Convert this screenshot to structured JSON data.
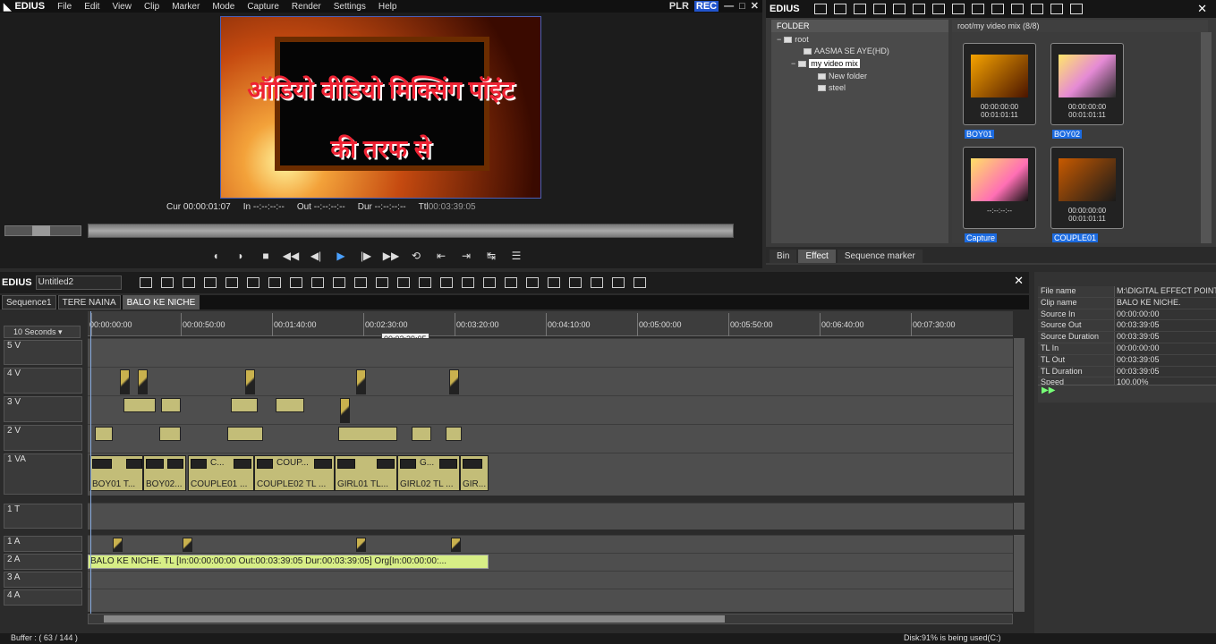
{
  "app": {
    "name": "EDIUS"
  },
  "menu": [
    "File",
    "Edit",
    "View",
    "Clip",
    "Marker",
    "Mode",
    "Capture",
    "Render",
    "Settings",
    "Help"
  ],
  "player": {
    "plr": "PLR",
    "rec": "REC",
    "preview_line1": "ऑडियो वीडियो मिक्सिंग पॉइंट",
    "preview_line2": "की तरफ से",
    "cur_label": "Cur",
    "cur": "00:00:01:07",
    "in_label": "In",
    "in": "--:--:--:--",
    "out_label": "Out",
    "out": "--:--:--:--",
    "dur_label": "Dur",
    "dur": "--:--:--:--",
    "ttl_label": "Ttl",
    "ttl": "00:03:39:05"
  },
  "bin": {
    "title": "EDIUS",
    "folder_header": "FOLDER",
    "tree": [
      {
        "label": "root"
      },
      {
        "label": "AASMA SE AYE(HD)"
      },
      {
        "label": "my video mix",
        "selected": true
      },
      {
        "label": "New folder"
      },
      {
        "label": "steel"
      }
    ],
    "path": "root/my video mix (8/8)",
    "clips": [
      {
        "name": "BOY01",
        "tc1": "00:00:00:00",
        "tc2": "00:01:01:11"
      },
      {
        "name": "BOY02",
        "tc1": "00:00:00:00",
        "tc2": "00:01:01:11"
      },
      {
        "name": "Capture",
        "tc1": "--:--:--:--",
        "tc2": ""
      },
      {
        "name": "COUPLE01",
        "tc1": "00:00:00:00",
        "tc2": "00:01:01:11"
      }
    ],
    "tabs": [
      "Bin",
      "Effect",
      "Sequence marker"
    ]
  },
  "timeline": {
    "title": "EDIUS",
    "sequence_name": "Untitled2",
    "seq_tabs": [
      "Sequence1",
      "TERE NAINA",
      "BALO KE NICHE"
    ],
    "zoom": "10 Seconds",
    "ruler": [
      "00:00:00:00",
      "00:00:50:00",
      "00:01:40:00",
      "00:02:30:00",
      "00:03:20:00",
      "00:04:10:00",
      "00:05:00:00",
      "00:05:50:00",
      "00:06:40:00",
      "00:07:30:00"
    ],
    "tooltip": "00:02:39:05",
    "tracks": [
      "5 V",
      "4 V",
      "3 V",
      "2 V",
      "1 VA",
      "1 T",
      "1 A",
      "2 A",
      "3 A",
      "4 A"
    ],
    "va_clips": [
      {
        "label": "BOY01   T..."
      },
      {
        "label": "BOY02..."
      },
      {
        "label": "COUPLE01   ..."
      },
      {
        "label": "COUPLE02   TL ..."
      },
      {
        "label": "GIRL01   TL..."
      },
      {
        "label": "GIRL02   TL ..."
      },
      {
        "label": "GIR..."
      }
    ],
    "va_top_labels": [
      "C...",
      "COUP...",
      "G..."
    ],
    "audio_clip": "BALO KE NICHE.  TL [In:00:00:00:00 Out:00:03:39:05 Dur:00:03:39:05]  Org[In:00:00:00:..."
  },
  "info": [
    {
      "k": "File name",
      "v": "M:\\DIGITAL EFFECT POINT\\"
    },
    {
      "k": "Clip name",
      "v": "BALO KE NICHE."
    },
    {
      "k": "Source In",
      "v": "00:00:00:00"
    },
    {
      "k": "Source Out",
      "v": "00:03:39:05"
    },
    {
      "k": "Source Duration",
      "v": "00:03:39:05"
    },
    {
      "k": "TL In",
      "v": "00:00:00:00"
    },
    {
      "k": "TL Out",
      "v": "00:03:39:05"
    },
    {
      "k": "TL Duration",
      "v": "00:03:39:05"
    },
    {
      "k": "Speed",
      "v": "100.00%"
    }
  ],
  "status": {
    "buffer": "Buffer : ( 63 / 144 )",
    "disk": "Disk:91% is being used(C:)"
  }
}
